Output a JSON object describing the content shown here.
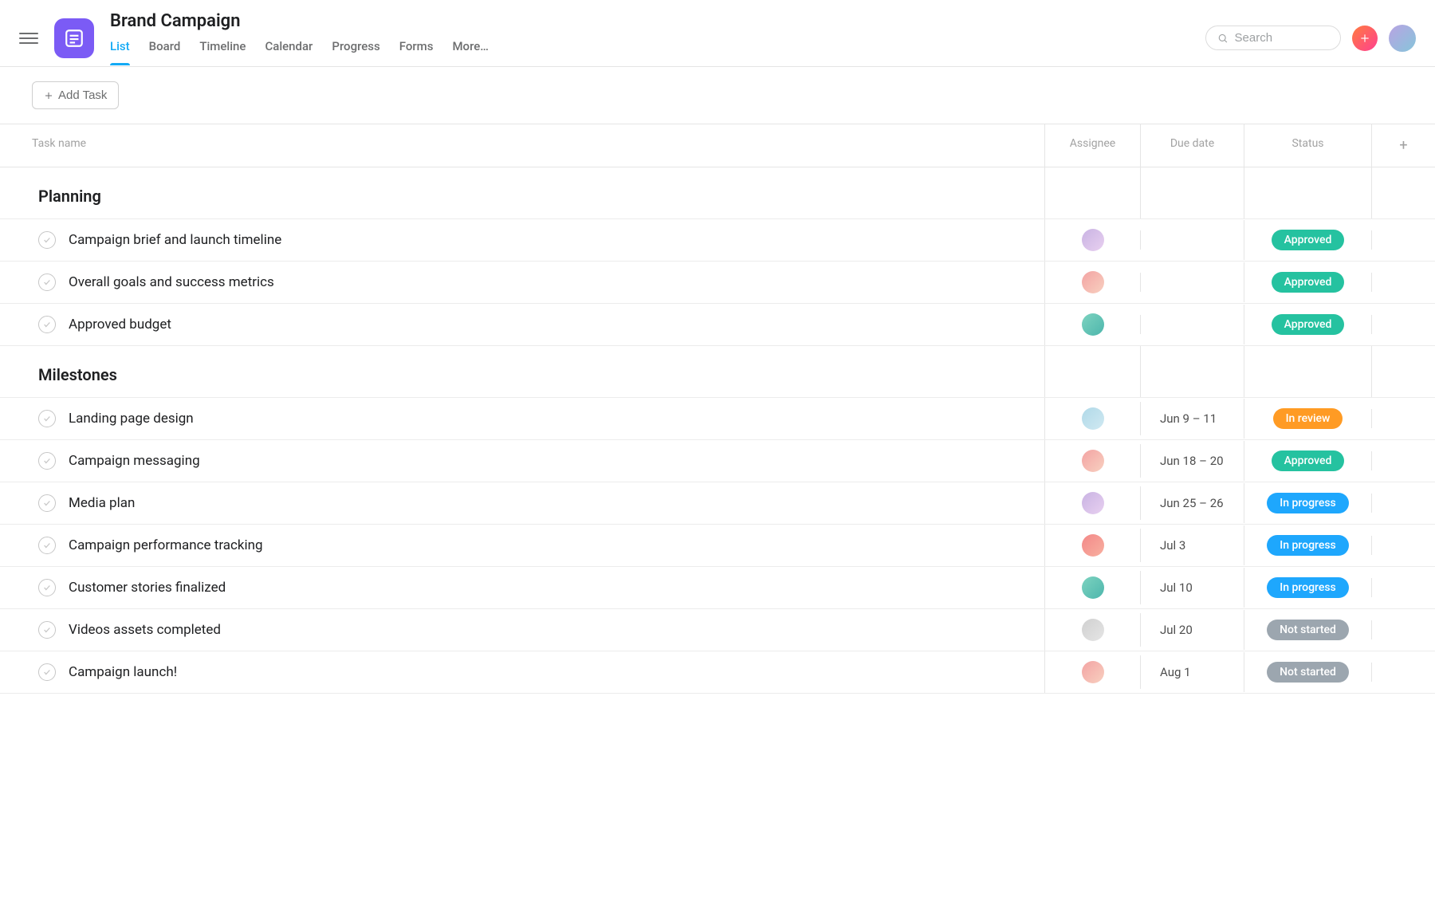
{
  "project": {
    "title": "Brand Campaign"
  },
  "search": {
    "placeholder": "Search"
  },
  "tabs": [
    "List",
    "Board",
    "Timeline",
    "Calendar",
    "Progress",
    "Forms",
    "More…"
  ],
  "active_tab": 0,
  "add_task_label": "Add Task",
  "columns": {
    "task_name": "Task name",
    "assignee": "Assignee",
    "due_date": "Due date",
    "status": "Status"
  },
  "status_colors": {
    "Approved": "#25c2a0",
    "In review": "#ff9b24",
    "In progress": "#1ea7fd",
    "Not started": "#9ca6af"
  },
  "avatar_colors": [
    "linear-gradient(135deg,#c9b3e3,#e8d0f0)",
    "linear-gradient(135deg,#f3a3a3,#f8d0c0)",
    "linear-gradient(135deg,#7dd3c0,#4db6ac)",
    "linear-gradient(135deg,#b0d9e8,#d0e9f2)",
    "linear-gradient(135deg,#f3a3a3,#f8d0c0)",
    "linear-gradient(135deg,#c9b3e3,#e8d0f0)",
    "linear-gradient(135deg,#f38888,#f8b0a0)",
    "linear-gradient(135deg,#7dd3c0,#4db6ac)",
    "linear-gradient(135deg,#d0d0d0,#e5e5e5)",
    "linear-gradient(135deg,#f3a3a3,#f8d0c0)"
  ],
  "sections": [
    {
      "name": "Planning",
      "tasks": [
        {
          "name": "Campaign brief and launch timeline",
          "assignee_idx": 0,
          "due": "",
          "status": "Approved"
        },
        {
          "name": "Overall goals and success metrics",
          "assignee_idx": 1,
          "due": "",
          "status": "Approved"
        },
        {
          "name": "Approved budget",
          "assignee_idx": 2,
          "due": "",
          "status": "Approved"
        }
      ]
    },
    {
      "name": "Milestones",
      "tasks": [
        {
          "name": "Landing page design",
          "assignee_idx": 3,
          "due": "Jun 9 – 11",
          "status": "In review"
        },
        {
          "name": "Campaign messaging",
          "assignee_idx": 4,
          "due": "Jun 18 – 20",
          "status": "Approved"
        },
        {
          "name": "Media plan",
          "assignee_idx": 5,
          "due": "Jun 25 – 26",
          "status": "In progress"
        },
        {
          "name": "Campaign performance tracking",
          "assignee_idx": 6,
          "due": "Jul 3",
          "status": "In progress"
        },
        {
          "name": "Customer stories finalized",
          "assignee_idx": 7,
          "due": "Jul 10",
          "status": "In progress"
        },
        {
          "name": "Videos assets completed",
          "assignee_idx": 8,
          "due": "Jul 20",
          "status": "Not started"
        },
        {
          "name": "Campaign launch!",
          "assignee_idx": 9,
          "due": "Aug 1",
          "status": "Not started"
        }
      ]
    }
  ]
}
